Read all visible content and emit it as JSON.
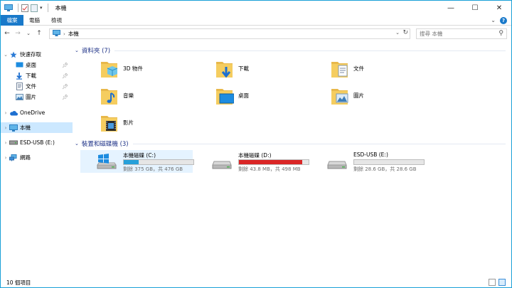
{
  "window": {
    "title": "本機",
    "controls": {
      "minimize": "—",
      "maximize": "☐",
      "close": "✕"
    }
  },
  "ribbon": {
    "tabs": [
      "檔案",
      "電腦",
      "檢視"
    ],
    "expand": "⌄",
    "help": "?"
  },
  "address": {
    "back": "←",
    "forward": "→",
    "recent": "⌄",
    "up": "↑",
    "crumb_chevron": "›",
    "path": "本機",
    "dropdown": "⌄",
    "refresh": "↻",
    "search_placeholder": "搜尋 本機",
    "search_icon": "⚲"
  },
  "sidebar": {
    "quick_access": "快速存取",
    "quick_items": [
      {
        "label": "桌面",
        "icon": "desktop-icon"
      },
      {
        "label": "下載",
        "icon": "downloads-icon"
      },
      {
        "label": "文件",
        "icon": "documents-icon"
      },
      {
        "label": "圖片",
        "icon": "pictures-icon"
      }
    ],
    "onedrive": "OneDrive",
    "this_pc": "本機",
    "usb": "ESD-USB (E:)",
    "network": "網路",
    "expand_glyph": "›"
  },
  "main": {
    "folders_header": "資料夾 (7)",
    "folders": [
      {
        "name": "3D 物件",
        "icon": "3d-objects-icon"
      },
      {
        "name": "下載",
        "icon": "downloads-icon"
      },
      {
        "name": "文件",
        "icon": "documents-icon"
      },
      {
        "name": "音樂",
        "icon": "music-icon"
      },
      {
        "name": "桌面",
        "icon": "desktop-icon"
      },
      {
        "name": "圖片",
        "icon": "pictures-icon"
      },
      {
        "name": "影片",
        "icon": "videos-icon"
      }
    ],
    "drives_header": "裝置和磁碟機 (3)",
    "drives": [
      {
        "name": "本機磁碟 (C:)",
        "free": "剩餘 375 GB，共 476 GB",
        "used_fraction": 0.21,
        "bar_color": "#26a0da",
        "selected": true,
        "icon": "windows-drive-icon"
      },
      {
        "name": "本機磁碟 (D:)",
        "free": "剩餘 43.8 MB，共 498 MB",
        "used_fraction": 0.91,
        "bar_color": "#da2626",
        "selected": false,
        "icon": "hard-drive-icon"
      },
      {
        "name": "ESD-USB (E:)",
        "free": "剩餘 28.6 GB，共 28.6 GB",
        "used_fraction": 0.0,
        "bar_color": "#26a0da",
        "selected": false,
        "icon": "usb-drive-icon"
      }
    ]
  },
  "status": {
    "item_count": "10 個項目"
  },
  "colors": {
    "accent": "#1979ca",
    "selection": "#cce8ff",
    "header_text": "#1e3287"
  }
}
